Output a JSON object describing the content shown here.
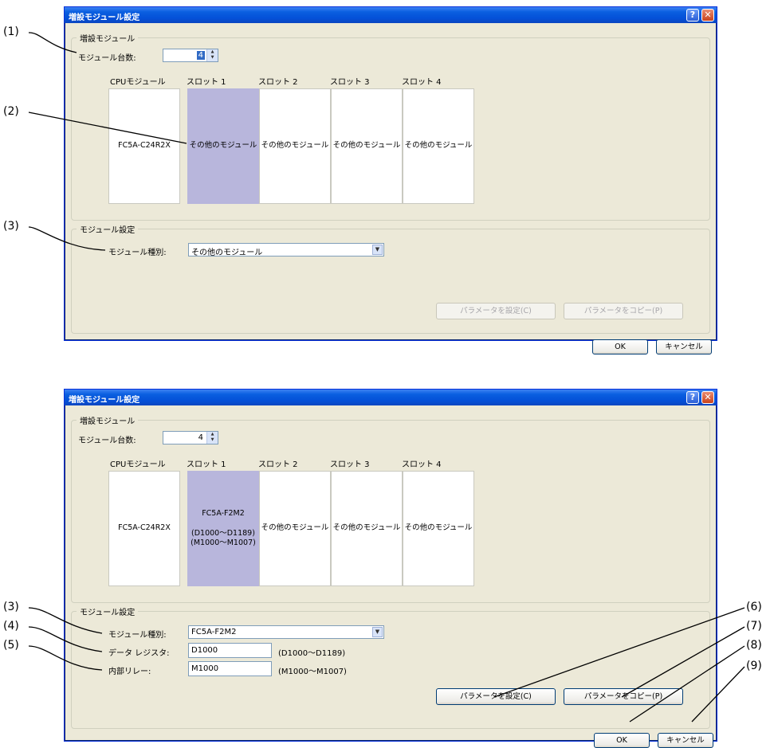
{
  "dialog_top": {
    "title": "増設モジュール設定",
    "help_label": "?",
    "close_label": "✕",
    "group_expansion": "増設モジュール",
    "module_count_label": "モジュール台数:",
    "module_count_value": "4",
    "slot_headers": [
      "CPUモジュール",
      "スロット 1",
      "スロット 2",
      "スロット 3",
      "スロット 4"
    ],
    "slots": [
      "FC5A-C24R2X",
      "その他のモジュール",
      "その他のモジュール",
      "その他のモジュール",
      "その他のモジュール"
    ],
    "group_settings": "モジュール設定",
    "module_type_label": "モジュール種別:",
    "module_type_value": "その他のモジュール",
    "set_params_button": "パラメータを設定(C)",
    "copy_params_button": "パラメータをコピー(P)",
    "ok_button": "OK",
    "cancel_button": "キャンセル"
  },
  "dialog_bottom": {
    "title": "増設モジュール設定",
    "help_label": "?",
    "close_label": "✕",
    "group_expansion": "増設モジュール",
    "module_count_label": "モジュール台数:",
    "module_count_value": "4",
    "slot_headers": [
      "CPUモジュール",
      "スロット 1",
      "スロット 2",
      "スロット 3",
      "スロット 4"
    ],
    "slots": [
      "FC5A-C24R2X",
      "FC5A-F2M2\n\n(D1000～D1189)\n(M1000～M1007)",
      "その他のモジュール",
      "その他のモジュール",
      "その他のモジュール"
    ],
    "group_settings": "モジュール設定",
    "module_type_label": "モジュール種別:",
    "module_type_value": "FC5A-F2M2",
    "data_register_label": "データ レジスタ:",
    "data_register_value": "D1000",
    "data_register_range": "(D1000～D1189)",
    "internal_relay_label": "内部リレー:",
    "internal_relay_value": "M1000",
    "internal_relay_range": "(M1000～M1007)",
    "set_params_button": "パラメータを設定(C)",
    "copy_params_button": "パラメータをコピー(P)",
    "ok_button": "OK",
    "cancel_button": "キャンセル"
  },
  "callouts": {
    "c1": "(1)",
    "c2": "(2)",
    "c3a": "(3)",
    "c3b": "(3)",
    "c4": "(4)",
    "c5": "(5)",
    "c6": "(6)",
    "c7": "(7)",
    "c8": "(8)",
    "c9": "(9)"
  },
  "icons": {
    "spin": "spin-arrows-icon",
    "dropdown": "dropdown-arrow-icon",
    "close": "close-icon",
    "help": "help-icon"
  }
}
